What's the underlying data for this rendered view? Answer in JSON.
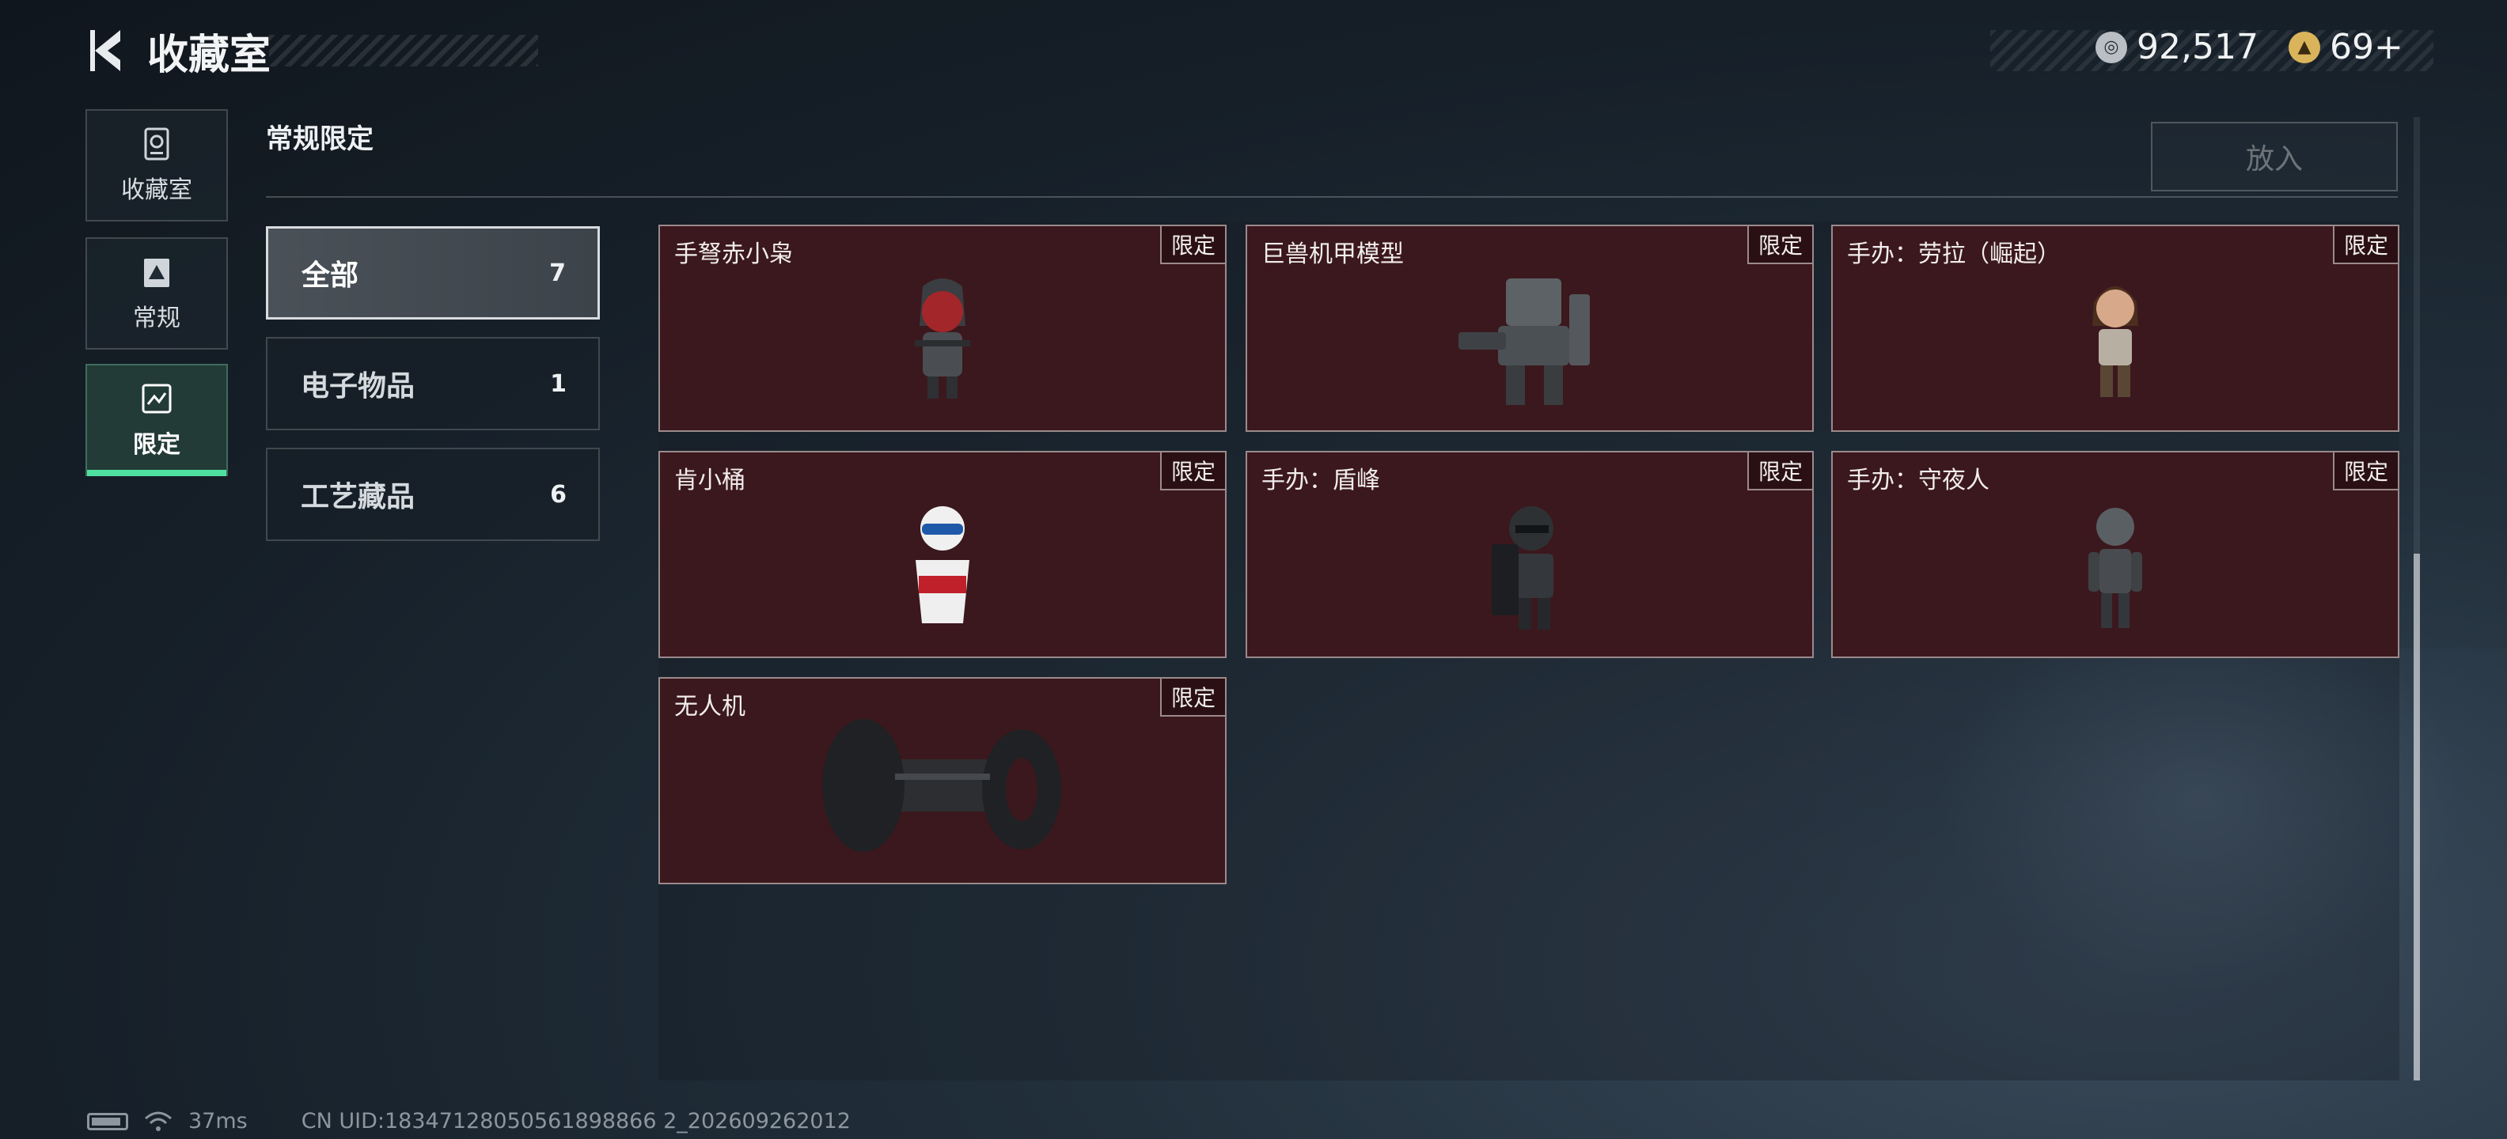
{
  "header": {
    "title": "收藏室"
  },
  "currency": [
    {
      "icon": "silver-coin-icon",
      "value": "92,517"
    },
    {
      "icon": "gold-coin-icon",
      "value": "69+"
    }
  ],
  "sidebar": {
    "tabs": [
      {
        "label": "收藏室",
        "icon": "vault-icon",
        "active": false
      },
      {
        "label": "常规",
        "icon": "regular-item-icon",
        "active": false
      },
      {
        "label": "限定",
        "icon": "limited-item-icon",
        "active": true
      }
    ]
  },
  "section_title": "常规限定",
  "put_button": "放入",
  "categories": [
    {
      "label": "全部",
      "count": "7",
      "active": true
    },
    {
      "label": "电子物品",
      "count": "1",
      "active": false
    },
    {
      "label": "工艺藏品",
      "count": "6",
      "active": false
    }
  ],
  "items": [
    {
      "name": "手弩赤小枭",
      "badge": "限定",
      "art": "crossbow-figure-image"
    },
    {
      "name": "巨兽机甲模型",
      "badge": "限定",
      "art": "mech-model-image"
    },
    {
      "name": "手办：劳拉（崛起）",
      "badge": "限定",
      "art": "lara-figure-image"
    },
    {
      "name": "肯小桶",
      "badge": "限定",
      "art": "kfc-bucket-figure-image"
    },
    {
      "name": "手办：盾峰",
      "badge": "限定",
      "art": "shield-figure-image"
    },
    {
      "name": "手办：守夜人",
      "badge": "限定",
      "art": "nightwatch-figure-image"
    },
    {
      "name": "无人机",
      "badge": "限定",
      "art": "drone-image"
    }
  ],
  "footer": {
    "ping": "37ms",
    "uid": "CN UID:18347128050561898866 2_202609262012"
  },
  "colors": {
    "accent": "#4fe0a0",
    "card_bg": "#3b181d",
    "card_border": "#9b8a8c"
  }
}
